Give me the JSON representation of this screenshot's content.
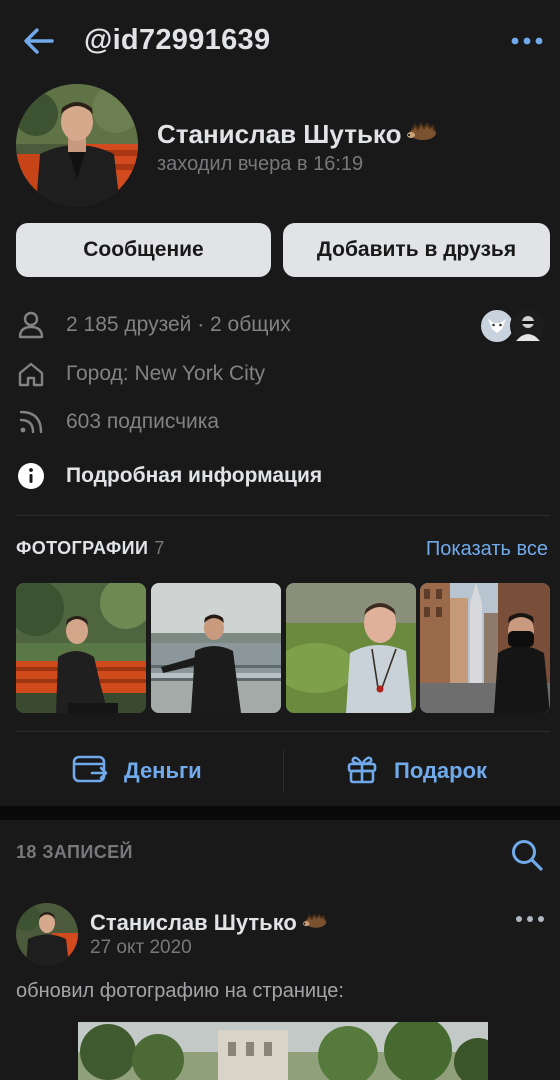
{
  "header": {
    "handle": "@id72991639"
  },
  "profile": {
    "name": "Станислав Шутько",
    "status": "заходил вчера в 16:19",
    "buttons": {
      "message": "Сообщение",
      "add_friend": "Добавить в друзья"
    },
    "info": {
      "friends": "2 185 друзей · 2 общих",
      "city": "Город: New York City",
      "followers": "603 подписчика",
      "details": "Подробная информация"
    }
  },
  "photos": {
    "title": "ФОТОГРАФИИ",
    "count": "7",
    "show_all": "Показать все",
    "thumbnails": [
      "photo-red-bench",
      "photo-waterfront",
      "photo-selfie-lake",
      "photo-city-street-mask"
    ]
  },
  "actions": {
    "money": "Деньги",
    "gift": "Подарок"
  },
  "posts": {
    "header": "18 ЗАПИСЕЙ",
    "items": [
      {
        "author": "Станислав Шутько",
        "date": "27 окт 2020",
        "text": "обновил фотографию на странице:"
      }
    ]
  },
  "colors": {
    "background": "#19191a",
    "accent": "#71aaeb",
    "text_primary": "#e1e3e6",
    "text_secondary": "#76787a",
    "button_bg": "#e1e3e6"
  },
  "icons": [
    "back-arrow-icon",
    "more-dots-icon",
    "hedgehog-emoji-icon",
    "user-icon",
    "home-icon",
    "rss-icon",
    "info-icon",
    "wallet-icon",
    "gift-icon",
    "search-icon"
  ]
}
